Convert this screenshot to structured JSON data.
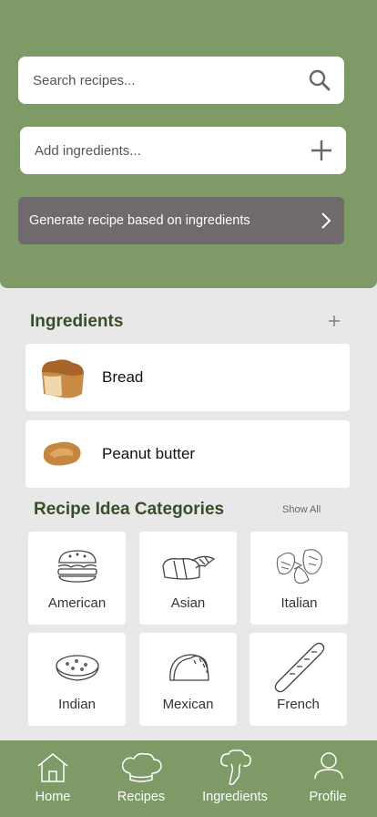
{
  "search": {
    "placeholder": "Search recipes..."
  },
  "add_ingredient": {
    "placeholder": "Add ingredients..."
  },
  "generate": {
    "label": "Generate recipe based on ingredients"
  },
  "ingredients": {
    "title": "Ingredients",
    "items": [
      {
        "label": "Bread",
        "icon": "bread-icon"
      },
      {
        "label": "Peanut butter",
        "icon": "peanut-butter-icon"
      }
    ]
  },
  "categories": {
    "title": "Recipe Idea Categories",
    "show_all": "Show All",
    "items": [
      {
        "label": "American",
        "icon": "burger-icon"
      },
      {
        "label": "Asian",
        "icon": "sushi-icon"
      },
      {
        "label": "Italian",
        "icon": "pasta-icon"
      },
      {
        "label": "Indian",
        "icon": "naan-icon"
      },
      {
        "label": "Mexican",
        "icon": "taco-icon"
      },
      {
        "label": "French",
        "icon": "baguette-icon"
      }
    ]
  },
  "nav": {
    "items": [
      {
        "label": "Home",
        "icon": "home-icon"
      },
      {
        "label": "Recipes",
        "icon": "chef-hat-icon"
      },
      {
        "label": "Ingredients",
        "icon": "broccoli-icon"
      },
      {
        "label": "Profile",
        "icon": "profile-icon"
      }
    ]
  },
  "colors": {
    "header": "#7e9a66",
    "button": "#6f6b6c",
    "title": "#3a4d2a",
    "background": "#e8e8e8"
  }
}
